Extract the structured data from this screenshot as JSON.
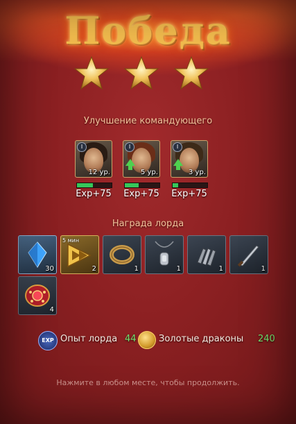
{
  "title": "Победа",
  "stars_earned": 3,
  "commander_section": {
    "label": "Улучшение командующего",
    "heroes": [
      {
        "rank": "I",
        "level": "12 ур.",
        "exp": "Exp+75",
        "level_up": false,
        "progress": 0.45
      },
      {
        "rank": "I",
        "level": "5 ур.",
        "exp": "Exp+75",
        "level_up": true,
        "progress": 0.4
      },
      {
        "rank": "I",
        "level": "3 ур.",
        "exp": "Exp+75",
        "level_up": true,
        "progress": 0.15
      }
    ]
  },
  "lord_section": {
    "label": "Награда лорда",
    "items": [
      {
        "icon": "blue-crystal-icon",
        "count": "30"
      },
      {
        "icon": "speed-up-icon",
        "badge": "5 мин",
        "count": "2"
      },
      {
        "icon": "ring-icon",
        "count": "1"
      },
      {
        "icon": "amulet-icon",
        "count": "1"
      },
      {
        "icon": "gauntlet-icon",
        "count": "1"
      },
      {
        "icon": "dagger-icon",
        "count": "1"
      },
      {
        "icon": "red-brooch-icon",
        "count": "4"
      }
    ]
  },
  "footer": {
    "exp_badge": "EXP",
    "lord_exp_label": "Опыт лорда",
    "lord_exp_value": "44",
    "gold_label": "Золотые драконы",
    "gold_value": "240"
  },
  "hint": "Нажмите в любом месте, чтобы продолжить.",
  "colors": {
    "accent_green": "#6fe36f",
    "title_gold": "#f3bc4e",
    "background": "#8c2022"
  }
}
